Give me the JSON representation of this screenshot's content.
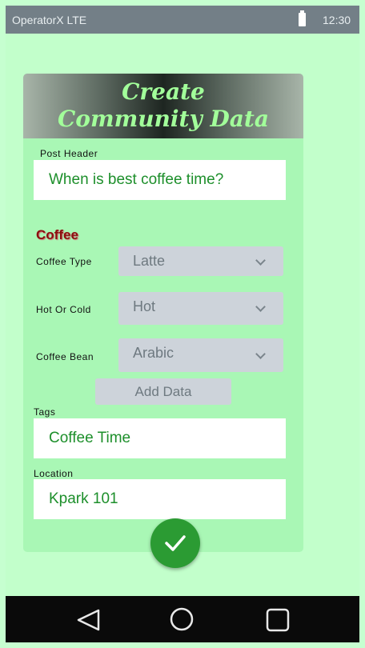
{
  "status_bar": {
    "carrier": "OperatorX LTE",
    "time": "12:30",
    "battery_icon": "battery-icon"
  },
  "header": {
    "title_line1": "Create",
    "title_line2": "Community Data"
  },
  "post_header": {
    "label": "Post Header",
    "value": "When is best coffee time?"
  },
  "coffee_section": {
    "title": "Coffee",
    "coffee_type": {
      "label": "Coffee Type",
      "value": "Latte"
    },
    "hot_or_cold": {
      "label": "Hot Or Cold",
      "value": "Hot"
    },
    "coffee_bean": {
      "label": "Coffee Bean",
      "value": "Arabic"
    },
    "add_button": "Add Data"
  },
  "tags": {
    "label": "Tags",
    "value": "Coffee Time"
  },
  "location": {
    "label": "Location",
    "value": "Kpark 101"
  },
  "colors": {
    "background": "#c2ffcb",
    "card": "#a9f7b5",
    "accent": "#2b9b33",
    "section_title": "#8b0f0f",
    "field_text": "#1d8f2b"
  },
  "icons": [
    "battery-icon",
    "check-icon",
    "back-icon",
    "home-icon",
    "recents-icon"
  ]
}
